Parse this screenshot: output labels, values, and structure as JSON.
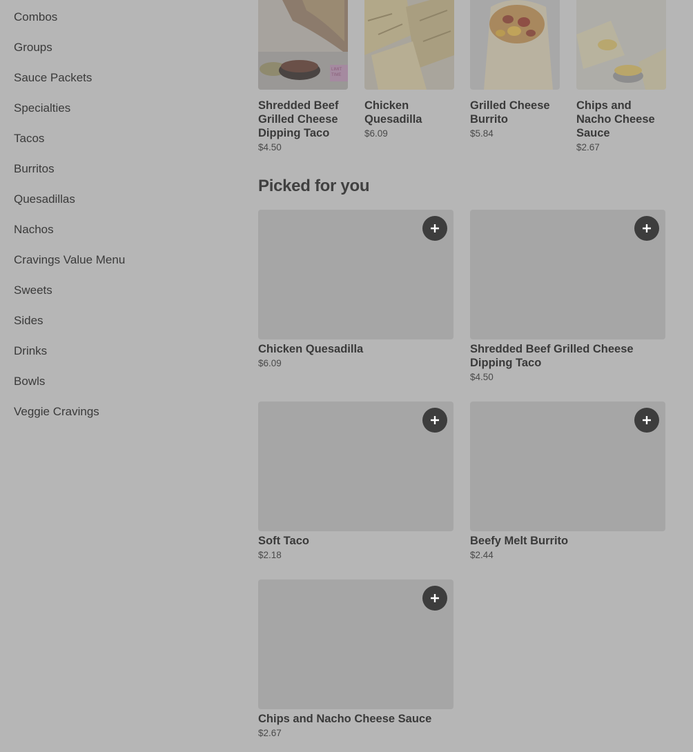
{
  "sidebar": {
    "items": [
      {
        "label": "Combos"
      },
      {
        "label": "Groups"
      },
      {
        "label": "Sauce Packets"
      },
      {
        "label": "Specialties"
      },
      {
        "label": "Tacos"
      },
      {
        "label": "Burritos"
      },
      {
        "label": "Quesadillas"
      },
      {
        "label": "Nachos"
      },
      {
        "label": "Cravings Value Menu"
      },
      {
        "label": "Sweets"
      },
      {
        "label": "Sides"
      },
      {
        "label": "Drinks"
      },
      {
        "label": "Bowls"
      },
      {
        "label": "Veggie Cravings"
      }
    ]
  },
  "carousel": {
    "items": [
      {
        "title": "Shredded Beef Grilled Cheese Dipping Taco",
        "price": "$4.50",
        "badge": "LIMITED TIME"
      },
      {
        "title": "Chicken Quesadilla",
        "price": "$6.09"
      },
      {
        "title": "Grilled Cheese Burrito",
        "price": "$5.84"
      },
      {
        "title": "Chips and Nacho Cheese Sauce",
        "price": "$2.67"
      }
    ]
  },
  "picked": {
    "title": "Picked for you",
    "items": [
      {
        "title": "Chicken Quesadilla",
        "price": "$6.09"
      },
      {
        "title": "Shredded Beef Grilled Cheese Dipping Taco",
        "price": "$4.50"
      },
      {
        "title": "Soft Taco",
        "price": "$2.18"
      },
      {
        "title": "Beefy Melt Burrito",
        "price": "$2.44"
      },
      {
        "title": "Chips and Nacho Cheese Sauce",
        "price": "$2.67"
      }
    ]
  },
  "icons": {
    "add": "plus-icon"
  }
}
